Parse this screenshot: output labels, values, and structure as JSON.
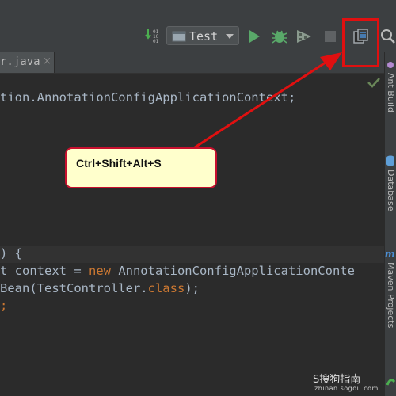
{
  "toolbar": {
    "run_config_label": "Test",
    "icons": [
      "make-icon",
      "run-icon",
      "debug-icon",
      "coverage-icon",
      "stop-icon",
      "project-structure-icon",
      "search-icon"
    ],
    "accent_green": "#4caf50",
    "highlight_color": "#e01010"
  },
  "tab": {
    "label": "r.java",
    "close_label": "×"
  },
  "editor": {
    "lines": {
      "import_line": "tion.AnnotationConfigApplicationContext;",
      "method_open": ") {",
      "ctx_prefix": "t context = ",
      "ctx_new": "new",
      "ctx_suffix": " AnnotationConfigApplicationConte",
      "bean_prefix": "Bean(TestController.",
      "bean_class": "class",
      "bean_suffix": ");",
      "semicolon": ";"
    },
    "keyword_color": "#cc7832",
    "text_color": "#a9b7c6"
  },
  "side_panels": [
    "Ant Build",
    "Database",
    "Maven Projects"
  ],
  "callout": {
    "text": "Ctrl+Shift+Alt+S"
  },
  "watermark": {
    "main": "S搜狗指南",
    "sub": "zhinan.sogou.com"
  }
}
